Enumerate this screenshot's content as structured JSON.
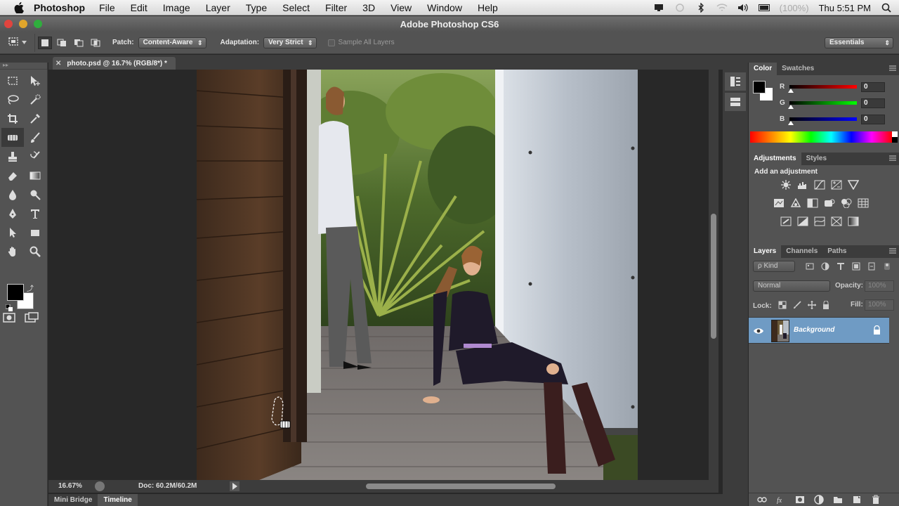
{
  "menubar": {
    "app_name": "Photoshop",
    "items": [
      "File",
      "Edit",
      "Image",
      "Layer",
      "Type",
      "Select",
      "Filter",
      "3D",
      "View",
      "Window",
      "Help"
    ],
    "battery": "(100%)",
    "clock": "Thu 5:51 PM"
  },
  "window": {
    "title": "Adobe Photoshop CS6"
  },
  "options_bar": {
    "patch_label": "Patch:",
    "patch_value": "Content-Aware",
    "adaptation_label": "Adaptation:",
    "adaptation_value": "Very Strict",
    "sample_all_layers_label": "Sample All Layers",
    "sample_all_layers_checked": false,
    "workspace": "Essentials"
  },
  "document": {
    "tab_title": "photo.psd @ 16.7% (RGB/8*) *",
    "zoom": "16.67%",
    "doc_info": "Doc: 60.2M/60.2M"
  },
  "bottom_tabs": [
    "Mini Bridge",
    "Timeline"
  ],
  "color_panel": {
    "tabs": [
      "Color",
      "Swatches"
    ],
    "channels": [
      {
        "label": "R",
        "value": "0"
      },
      {
        "label": "G",
        "value": "0"
      },
      {
        "label": "B",
        "value": "0"
      }
    ]
  },
  "adjustments_panel": {
    "tabs": [
      "Adjustments",
      "Styles"
    ],
    "title": "Add an adjustment"
  },
  "layers_panel": {
    "tabs": [
      "Layers",
      "Channels",
      "Paths"
    ],
    "filter_label": "ρ Kind",
    "blend_mode": "Normal",
    "opacity_label": "Opacity:",
    "opacity_value": "100%",
    "lock_label": "Lock:",
    "fill_label": "Fill:",
    "fill_value": "100%",
    "layers": [
      {
        "name": "Background",
        "locked": true,
        "visible": true
      }
    ]
  },
  "colors": {
    "accent_selected_layer": "#6f9bc4",
    "panel_bg": "#535353",
    "canvas_bg": "#282828"
  }
}
